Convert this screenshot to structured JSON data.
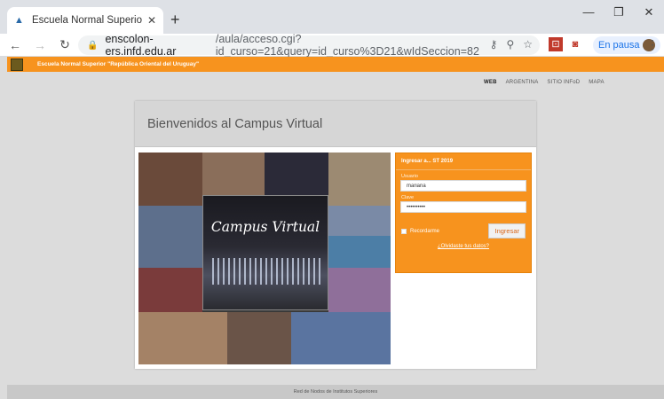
{
  "browser": {
    "tab_title": "Escuela Normal Superior \"Repúbl",
    "new_tab_label": "+",
    "url_host": "enscolon-ers.infd.edu.ar",
    "url_path": "/aula/acceso.cgi?id_curso=21&query=id_curso%3D21&wIdSeccion=82",
    "profile_status": "En pausa"
  },
  "site": {
    "school_name": "Escuela Normal Superior \"República Oriental del Uruguay\"",
    "topnav": [
      "WEB",
      "ARGENTINA",
      "SITIO INFoD",
      "MAPA"
    ],
    "card_title": "Bienvenidos al Campus Virtual",
    "collage_title": "Campus Virtual",
    "footer_text": "Red de Nodos de Institutos Superiores"
  },
  "login": {
    "title": "Ingresar a... ST 2019",
    "user_label": "Usuario",
    "user_value": "mariana",
    "password_label": "Clave",
    "password_value": "••••••••••",
    "remember_label": "Recordarme",
    "submit_label": "Ingresar",
    "forgot_link": "¿Olvidaste tus datos?"
  },
  "colors": {
    "accent": "#f7931e",
    "page_bg": "#dcdcdc"
  }
}
